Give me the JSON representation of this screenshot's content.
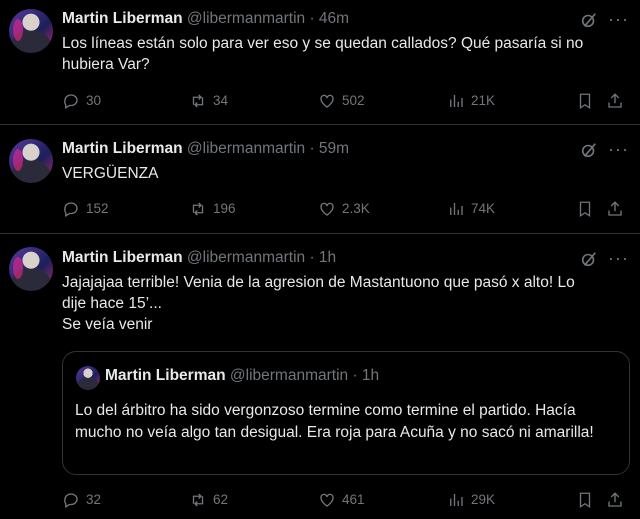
{
  "tweets": [
    {
      "author_name": "Martin Liberman",
      "handle": "@libermanmartin",
      "time": "· 46m",
      "text": "Los líneas están solo para ver eso y se quedan callados? Qué pasaría si no hubiera Var?",
      "replies": "30",
      "retweets": "34",
      "likes": "502",
      "views": "21K"
    },
    {
      "author_name": "Martin Liberman",
      "handle": "@libermanmartin",
      "time": "· 59m",
      "text": "VERGÜENZA",
      "replies": "152",
      "retweets": "196",
      "likes": "2.3K",
      "views": "74K"
    },
    {
      "author_name": "Martin Liberman",
      "handle": "@libermanmartin",
      "time": "· 1h",
      "text_line1": "Jajajajaa terrible! Venia de la agresion de Mastantuono que pasó x alto! Lo",
      "text_line2": "dije hace 15’...",
      "text_line3": "Se veía venir",
      "quote": {
        "author_name": "Martin Liberman",
        "handle": "@libermanmartin",
        "time": "· 1h",
        "text": "Lo del árbitro ha sido vergonzoso termine como termine el partido. Hacía mucho no veía algo tan desigual. Era roja para Acuña y no sacó ni amarilla!"
      },
      "replies": "32",
      "retweets": "62",
      "likes": "461",
      "views": "29K"
    }
  ],
  "icons": {
    "reply": "reply-icon",
    "retweet": "retweet-icon",
    "like": "heart-icon",
    "views": "views-icon",
    "bookmark": "bookmark-icon",
    "share": "share-icon",
    "grok": "grok-icon",
    "more": "more-icon"
  },
  "colors": {
    "background": "#000000",
    "text": "#e7e9ea",
    "secondary": "#71767b",
    "border": "#2f3336"
  }
}
